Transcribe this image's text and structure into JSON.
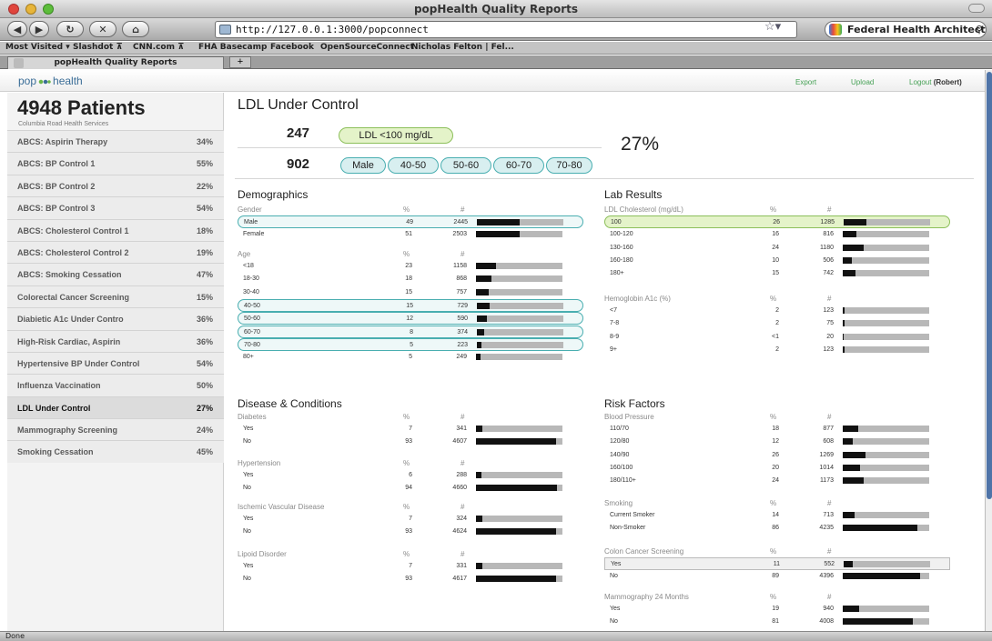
{
  "browser": {
    "window_title": "popHealth Quality Reports",
    "url": "http://127.0.0.1:3000/popconnect",
    "search_text": "Federal Health Architect",
    "bookmarks": [
      "Most Visited ▾",
      "Slashdot ⊼",
      "CNN.com ⊼",
      "FHA Basecamp",
      "Facebook",
      "OpenSourceConnect",
      "Nicholas Felton | Fel..."
    ],
    "tab_title": "popHealth Quality Reports",
    "new_tab": "+",
    "status": "Done"
  },
  "header": {
    "logo_pop": "pop",
    "logo_health": "health",
    "links": {
      "export": "Export",
      "upload": "Upload",
      "logout": "Logout",
      "user": "(Robert)"
    }
  },
  "sidebar": {
    "patients": "4948 Patients",
    "org": "Columbia Road Health Services",
    "measures": [
      {
        "label": "ABCS: Aspirin Therapy",
        "pct": "34%"
      },
      {
        "label": "ABCS: BP Control 1",
        "pct": "55%"
      },
      {
        "label": "ABCS: BP Control 2",
        "pct": "22%"
      },
      {
        "label": "ABCS: BP Control 3",
        "pct": "54%"
      },
      {
        "label": "ABCS: Cholesterol Control 1",
        "pct": "18%"
      },
      {
        "label": "ABCS: Cholesterol Control 2",
        "pct": "19%"
      },
      {
        "label": "ABCS: Smoking Cessation",
        "pct": "47%"
      },
      {
        "label": "Colorectal Cancer Screening",
        "pct": "15%"
      },
      {
        "label": "Diabietic A1c Under Contro",
        "pct": "36%"
      },
      {
        "label": "High-Risk Cardiac, Aspirin",
        "pct": "36%"
      },
      {
        "label": "Hypertensive BP Under Control",
        "pct": "54%"
      },
      {
        "label": "Influenza Vaccination",
        "pct": "50%"
      },
      {
        "label": "LDL Under Control",
        "pct": "27%",
        "selected": true
      },
      {
        "label": "Mammography Screening",
        "pct": "24%"
      },
      {
        "label": "Smoking Cessation",
        "pct": "45%"
      }
    ]
  },
  "main": {
    "title": "LDL Under Control",
    "numerator": "247",
    "numerator_filter": "LDL <100 mg/dL",
    "denominator": "902",
    "denominator_filters": [
      "Male",
      "40-50",
      "50-60",
      "60-70",
      "70-80"
    ],
    "ratio": "27%",
    "col_pct": "%",
    "col_count": "#",
    "sections": [
      {
        "title": "Demographics",
        "groups": [
          {
            "name": "Gender",
            "rows": [
              {
                "label": "Male",
                "pct": "49",
                "count": "2445",
                "fill": 0.49,
                "hl": "teal"
              },
              {
                "label": "Female",
                "pct": "51",
                "count": "2503",
                "fill": 0.51
              }
            ]
          },
          {
            "name": "Age",
            "rows": [
              {
                "label": "<18",
                "pct": "23",
                "count": "1158",
                "fill": 0.23
              },
              {
                "label": "18-30",
                "pct": "18",
                "count": "868",
                "fill": 0.18
              },
              {
                "label": "30-40",
                "pct": "15",
                "count": "757",
                "fill": 0.15
              },
              {
                "label": "40-50",
                "pct": "15",
                "count": "729",
                "fill": 0.15,
                "hl": "teal"
              },
              {
                "label": "50-60",
                "pct": "12",
                "count": "590",
                "fill": 0.12,
                "hl": "teal"
              },
              {
                "label": "60-70",
                "pct": "8",
                "count": "374",
                "fill": 0.08,
                "hl": "teal"
              },
              {
                "label": "70-80",
                "pct": "5",
                "count": "223",
                "fill": 0.05,
                "hl": "teal"
              },
              {
                "label": "80+",
                "pct": "5",
                "count": "249",
                "fill": 0.05
              }
            ]
          }
        ]
      },
      {
        "title": "Lab Results",
        "groups": [
          {
            "name": "LDL Cholesterol (mg/dL)",
            "rows": [
              {
                "label": "100",
                "pct": "26",
                "count": "1285",
                "fill": 0.26,
                "hl": "green"
              },
              {
                "label": "100-120",
                "pct": "16",
                "count": "816",
                "fill": 0.16
              },
              {
                "label": "130-160",
                "pct": "24",
                "count": "1180",
                "fill": 0.24
              },
              {
                "label": "160-180",
                "pct": "10",
                "count": "506",
                "fill": 0.1
              },
              {
                "label": "180+",
                "pct": "15",
                "count": "742",
                "fill": 0.15
              }
            ]
          },
          {
            "name": "Hemoglobin A1c (%)",
            "rows": [
              {
                "label": "<7",
                "pct": "2",
                "count": "123",
                "fill": 0.02
              },
              {
                "label": "7-8",
                "pct": "2",
                "count": "75",
                "fill": 0.02
              },
              {
                "label": "8-9",
                "pct": "<1",
                "count": "20",
                "fill": 0.005
              },
              {
                "label": "9+",
                "pct": "2",
                "count": "123",
                "fill": 0.02
              }
            ]
          }
        ]
      },
      {
        "title": "Disease & Conditions",
        "groups": [
          {
            "name": "Diabetes",
            "rows": [
              {
                "label": "Yes",
                "pct": "7",
                "count": "341",
                "fill": 0.07
              },
              {
                "label": "No",
                "pct": "93",
                "count": "4607",
                "fill": 0.93
              }
            ]
          },
          {
            "name": "Hypertension",
            "rows": [
              {
                "label": "Yes",
                "pct": "6",
                "count": "288",
                "fill": 0.06
              },
              {
                "label": "No",
                "pct": "94",
                "count": "4660",
                "fill": 0.94
              }
            ]
          },
          {
            "name": "Ischemic Vascular Disease",
            "rows": [
              {
                "label": "Yes",
                "pct": "7",
                "count": "324",
                "fill": 0.07
              },
              {
                "label": "No",
                "pct": "93",
                "count": "4624",
                "fill": 0.93
              }
            ]
          },
          {
            "name": "Lipoid Disorder",
            "rows": [
              {
                "label": "Yes",
                "pct": "7",
                "count": "331",
                "fill": 0.07
              },
              {
                "label": "No",
                "pct": "93",
                "count": "4617",
                "fill": 0.93
              }
            ]
          }
        ]
      },
      {
        "title": "Risk Factors",
        "groups": [
          {
            "name": "Blood Pressure",
            "rows": [
              {
                "label": "110/70",
                "pct": "18",
                "count": "877",
                "fill": 0.18
              },
              {
                "label": "120/80",
                "pct": "12",
                "count": "608",
                "fill": 0.12
              },
              {
                "label": "140/90",
                "pct": "26",
                "count": "1269",
                "fill": 0.26
              },
              {
                "label": "160/100",
                "pct": "20",
                "count": "1014",
                "fill": 0.2
              },
              {
                "label": "180/110+",
                "pct": "24",
                "count": "1173",
                "fill": 0.24
              }
            ]
          },
          {
            "name": "Smoking",
            "rows": [
              {
                "label": "Current Smoker",
                "pct": "14",
                "count": "713",
                "fill": 0.14
              },
              {
                "label": "Non-Smoker",
                "pct": "86",
                "count": "4235",
                "fill": 0.86
              }
            ]
          },
          {
            "name": "Colon Cancer Screening",
            "rows": [
              {
                "label": "Yes",
                "pct": "11",
                "count": "552",
                "fill": 0.11,
                "hl": "gray"
              },
              {
                "label": "No",
                "pct": "89",
                "count": "4396",
                "fill": 0.89
              }
            ]
          },
          {
            "name": "Mammography 24 Months",
            "rows": [
              {
                "label": "Yes",
                "pct": "19",
                "count": "940",
                "fill": 0.19
              },
              {
                "label": "No",
                "pct": "81",
                "count": "4008",
                "fill": 0.81
              }
            ]
          }
        ]
      }
    ]
  }
}
